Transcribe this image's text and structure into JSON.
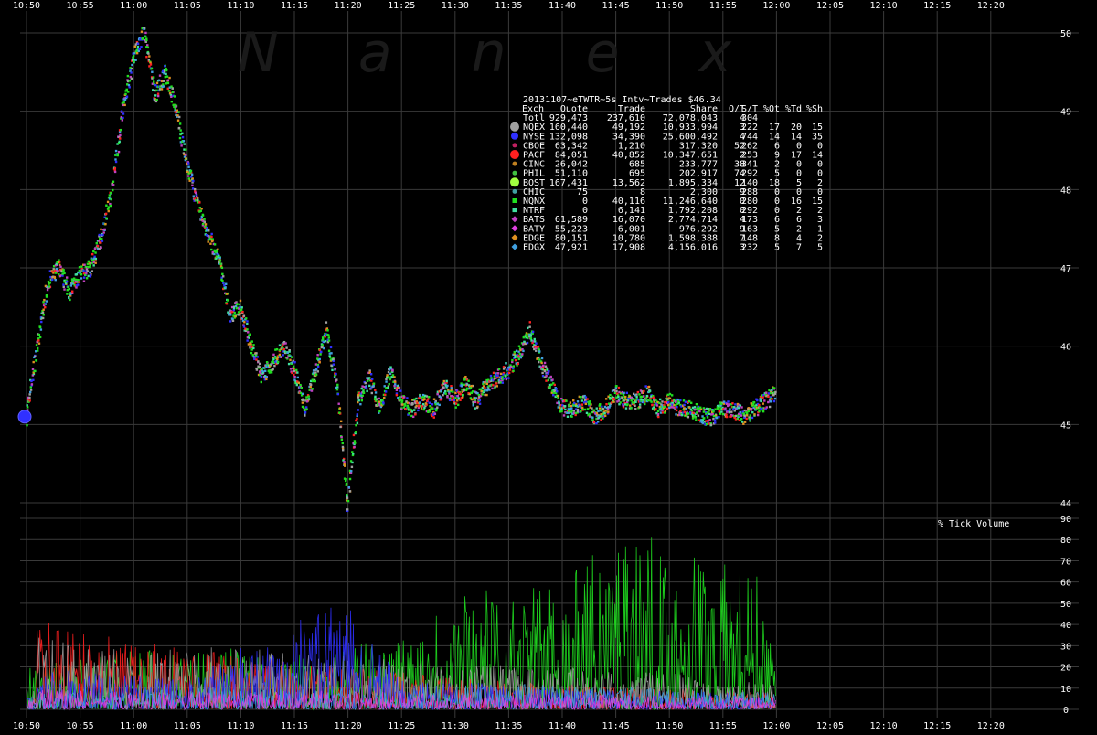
{
  "chart_data": [
    {
      "type": "scatter",
      "title": "20131107~eTWTR~5s Intv~Trades $46.34",
      "watermark": "Nanex",
      "x_ticks": [
        "10:50",
        "10:55",
        "11:00",
        "11:05",
        "11:10",
        "11:15",
        "11:20",
        "11:25",
        "11:30",
        "11:35",
        "11:40",
        "11:45",
        "11:50",
        "11:55",
        "12:00",
        "12:05",
        "12:10",
        "12:15",
        "12:20"
      ],
      "y_ticks": [
        44,
        45,
        46,
        47,
        48,
        49,
        50
      ],
      "ylim": [
        44,
        50.2
      ],
      "grid": true,
      "price_path": [
        [
          "10:50",
          45.1
        ],
        [
          "10:51",
          46.0
        ],
        [
          "10:52",
          46.8
        ],
        [
          "10:53",
          47.0
        ],
        [
          "10:54",
          46.7
        ],
        [
          "10:55",
          46.9
        ],
        [
          "10:56",
          47.0
        ],
        [
          "10:57",
          47.4
        ],
        [
          "10:58",
          48.0
        ],
        [
          "10:59",
          49.0
        ],
        [
          "11:00",
          49.7
        ],
        [
          "11:01",
          50.0
        ],
        [
          "11:02",
          49.2
        ],
        [
          "11:03",
          49.5
        ],
        [
          "11:04",
          49.0
        ],
        [
          "11:05",
          48.3
        ],
        [
          "11:06",
          47.8
        ],
        [
          "11:07",
          47.4
        ],
        [
          "11:08",
          47.1
        ],
        [
          "11:09",
          46.4
        ],
        [
          "11:10",
          46.5
        ],
        [
          "11:11",
          46.0
        ],
        [
          "11:12",
          45.6
        ],
        [
          "11:13",
          45.8
        ],
        [
          "11:14",
          46.0
        ],
        [
          "11:15",
          45.7
        ],
        [
          "11:16",
          45.2
        ],
        [
          "11:17",
          45.7
        ],
        [
          "11:18",
          46.2
        ],
        [
          "11:19",
          45.5
        ],
        [
          "11:20",
          44.0
        ],
        [
          "11:21",
          45.3
        ],
        [
          "11:22",
          45.6
        ],
        [
          "11:23",
          45.2
        ],
        [
          "11:24",
          45.7
        ],
        [
          "11:25",
          45.3
        ],
        [
          "11:26",
          45.2
        ],
        [
          "11:27",
          45.3
        ],
        [
          "11:28",
          45.2
        ],
        [
          "11:29",
          45.5
        ],
        [
          "11:30",
          45.3
        ],
        [
          "11:31",
          45.5
        ],
        [
          "11:32",
          45.3
        ],
        [
          "11:33",
          45.5
        ],
        [
          "11:34",
          45.6
        ],
        [
          "11:35",
          45.7
        ],
        [
          "11:36",
          45.9
        ],
        [
          "11:37",
          46.2
        ],
        [
          "11:38",
          45.8
        ],
        [
          "11:39",
          45.5
        ],
        [
          "11:40",
          45.2
        ],
        [
          "11:41",
          45.2
        ],
        [
          "11:42",
          45.3
        ],
        [
          "11:43",
          45.1
        ],
        [
          "11:44",
          45.2
        ],
        [
          "11:45",
          45.4
        ],
        [
          "11:46",
          45.3
        ],
        [
          "11:47",
          45.3
        ],
        [
          "11:48",
          45.4
        ],
        [
          "11:49",
          45.2
        ],
        [
          "11:50",
          45.3
        ],
        [
          "11:51",
          45.2
        ],
        [
          "11:52",
          45.2
        ],
        [
          "11:53",
          45.1
        ],
        [
          "11:54",
          45.1
        ],
        [
          "11:55",
          45.2
        ],
        [
          "11:56",
          45.2
        ],
        [
          "11:57",
          45.1
        ],
        [
          "11:58",
          45.2
        ],
        [
          "11:59",
          45.3
        ],
        [
          "12:00",
          45.4
        ]
      ],
      "legend": {
        "header": [
          "Exch",
          "Quote",
          "Trade",
          "Share",
          "Q/T",
          "S/T",
          "%Qt",
          "%Td",
          "%Sh"
        ],
        "rows": [
          {
            "exch": "Totl",
            "quote": "929,473",
            "trade": "237,610",
            "share": "72,078,043",
            "qt": "4",
            "st": "304",
            "pqt": "",
            "ptd": "",
            "psh": "",
            "color": "",
            "marker": "none"
          },
          {
            "exch": "NQEX",
            "quote": "160,440",
            "trade": "49,192",
            "share": "10,933,994",
            "qt": "3",
            "st": "222",
            "pqt": "17",
            "ptd": "20",
            "psh": "15",
            "color": "#a0a0a0",
            "marker": "big-circle"
          },
          {
            "exch": "NYSE",
            "quote": "132,098",
            "trade": "34,390",
            "share": "25,600,492",
            "qt": "4",
            "st": "744",
            "pqt": "14",
            "ptd": "14",
            "psh": "35",
            "color": "#3030ff",
            "marker": "circle"
          },
          {
            "exch": "CBOE",
            "quote": "63,342",
            "trade": "1,210",
            "share": "317,320",
            "qt": "52",
            "st": "262",
            "pqt": "6",
            "ptd": "0",
            "psh": "0",
            "color": "#c02060",
            "marker": "small-circle"
          },
          {
            "exch": "PACF",
            "quote": "84,051",
            "trade": "40,852",
            "share": "10,347,651",
            "qt": "2",
            "st": "253",
            "pqt": "9",
            "ptd": "17",
            "psh": "14",
            "color": "#ff2020",
            "marker": "big-circle"
          },
          {
            "exch": "CINC",
            "quote": "26,042",
            "trade": "685",
            "share": "233,777",
            "qt": "38",
            "st": "341",
            "pqt": "2",
            "ptd": "0",
            "psh": "0",
            "color": "#c08020",
            "marker": "small-circle"
          },
          {
            "exch": "PHIL",
            "quote": "51,110",
            "trade": "695",
            "share": "202,917",
            "qt": "74",
            "st": "292",
            "pqt": "5",
            "ptd": "0",
            "psh": "0",
            "color": "#40c040",
            "marker": "small-circle"
          },
          {
            "exch": "BOST",
            "quote": "167,431",
            "trade": "13,562",
            "share": "1,895,334",
            "qt": "12",
            "st": "140",
            "pqt": "18",
            "ptd": "5",
            "psh": "2",
            "color": "#a0ff40",
            "marker": "big-circle"
          },
          {
            "exch": "CHIC",
            "quote": "75",
            "trade": "8",
            "share": "2,300",
            "qt": "9",
            "st": "288",
            "pqt": "0",
            "ptd": "0",
            "psh": "0",
            "color": "#40a0a0",
            "marker": "small-circle"
          },
          {
            "exch": "NQNX",
            "quote": "0",
            "trade": "40,116",
            "share": "11,246,640",
            "qt": "0",
            "st": "280",
            "pqt": "0",
            "ptd": "16",
            "psh": "15",
            "color": "#20e020",
            "marker": "square"
          },
          {
            "exch": "NTRF",
            "quote": "0",
            "trade": "6,141",
            "share": "1,792,208",
            "qt": "0",
            "st": "292",
            "pqt": "0",
            "ptd": "2",
            "psh": "2",
            "color": "#40e0a0",
            "marker": "square"
          },
          {
            "exch": "BATS",
            "quote": "61,589",
            "trade": "16,070",
            "share": "2,774,714",
            "qt": "4",
            "st": "173",
            "pqt": "6",
            "ptd": "6",
            "psh": "3",
            "color": "#c040c0",
            "marker": "diamond"
          },
          {
            "exch": "BATY",
            "quote": "55,223",
            "trade": "6,001",
            "share": "976,292",
            "qt": "9",
            "st": "163",
            "pqt": "5",
            "ptd": "2",
            "psh": "1",
            "color": "#e040e0",
            "marker": "diamond"
          },
          {
            "exch": "EDGE",
            "quote": "80,151",
            "trade": "10,780",
            "share": "1,598,388",
            "qt": "7",
            "st": "148",
            "pqt": "8",
            "ptd": "4",
            "psh": "2",
            "color": "#e09020",
            "marker": "diamond"
          },
          {
            "exch": "EDGX",
            "quote": "47,921",
            "trade": "17,908",
            "share": "4,156,016",
            "qt": "3",
            "st": "232",
            "pqt": "5",
            "ptd": "7",
            "psh": "5",
            "color": "#40a0e0",
            "marker": "diamond"
          }
        ]
      }
    },
    {
      "type": "area",
      "title": "% Tick Volume",
      "x_ticks": [
        "10:50",
        "10:55",
        "11:00",
        "11:05",
        "11:10",
        "11:15",
        "11:20",
        "11:25",
        "11:30",
        "11:35",
        "11:40",
        "11:45",
        "11:50",
        "11:55",
        "12:00",
        "12:05",
        "12:10",
        "12:15",
        "12:20"
      ],
      "y_ticks": [
        0,
        10,
        20,
        30,
        40,
        50,
        60,
        70,
        80,
        90
      ],
      "ylim": [
        0,
        90
      ],
      "grid": true,
      "series": [
        {
          "color": "#20e020",
          "peaks": [
            [
              "10:52",
              22
            ],
            [
              "11:00",
              28
            ],
            [
              "11:08",
              30
            ],
            [
              "11:14",
              25
            ],
            [
              "11:20",
              30
            ],
            [
              "11:25",
              35
            ],
            [
              "11:30",
              60
            ],
            [
              "11:35",
              55
            ],
            [
              "11:40",
              62
            ],
            [
              "11:43",
              75
            ],
            [
              "11:46",
              90
            ],
            [
              "11:48",
              85
            ],
            [
              "11:50",
              68
            ],
            [
              "11:52",
              82
            ],
            [
              "11:55",
              70
            ],
            [
              "11:58",
              68
            ],
            [
              "12:00",
              20
            ]
          ]
        },
        {
          "color": "#ff2020",
          "peaks": [
            [
              "10:51",
              40
            ],
            [
              "10:53",
              42
            ],
            [
              "10:56",
              38
            ],
            [
              "11:00",
              30
            ],
            [
              "11:05",
              32
            ],
            [
              "11:10",
              25
            ],
            [
              "11:20",
              20
            ],
            [
              "11:30",
              15
            ],
            [
              "11:40",
              12
            ],
            [
              "11:50",
              10
            ],
            [
              "12:00",
              8
            ]
          ]
        },
        {
          "color": "#a0a0a0",
          "peaks": [
            [
              "10:51",
              35
            ],
            [
              "10:55",
              30
            ],
            [
              "11:00",
              28
            ],
            [
              "11:10",
              30
            ],
            [
              "11:20",
              25
            ],
            [
              "11:30",
              22
            ],
            [
              "11:40",
              20
            ],
            [
              "11:50",
              18
            ],
            [
              "12:00",
              12
            ]
          ]
        },
        {
          "color": "#3030ff",
          "peaks": [
            [
              "10:51",
              20
            ],
            [
              "10:55",
              18
            ],
            [
              "11:05",
              15
            ],
            [
              "11:19",
              55
            ],
            [
              "11:25",
              15
            ],
            [
              "11:40",
              10
            ],
            [
              "11:55",
              8
            ],
            [
              "12:00",
              6
            ]
          ]
        },
        {
          "color": "#40a0e0",
          "peaks": [
            [
              "10:51",
              12
            ],
            [
              "10:58",
              10
            ],
            [
              "11:10",
              10
            ],
            [
              "11:20",
              10
            ],
            [
              "11:35",
              12
            ],
            [
              "11:50",
              10
            ],
            [
              "12:00",
              8
            ]
          ]
        },
        {
          "color": "#e040e0",
          "peaks": [
            [
              "10:51",
              10
            ],
            [
              "11:00",
              8
            ],
            [
              "11:15",
              9
            ],
            [
              "11:30",
              8
            ],
            [
              "11:45",
              7
            ],
            [
              "12:00",
              6
            ]
          ]
        }
      ]
    }
  ]
}
